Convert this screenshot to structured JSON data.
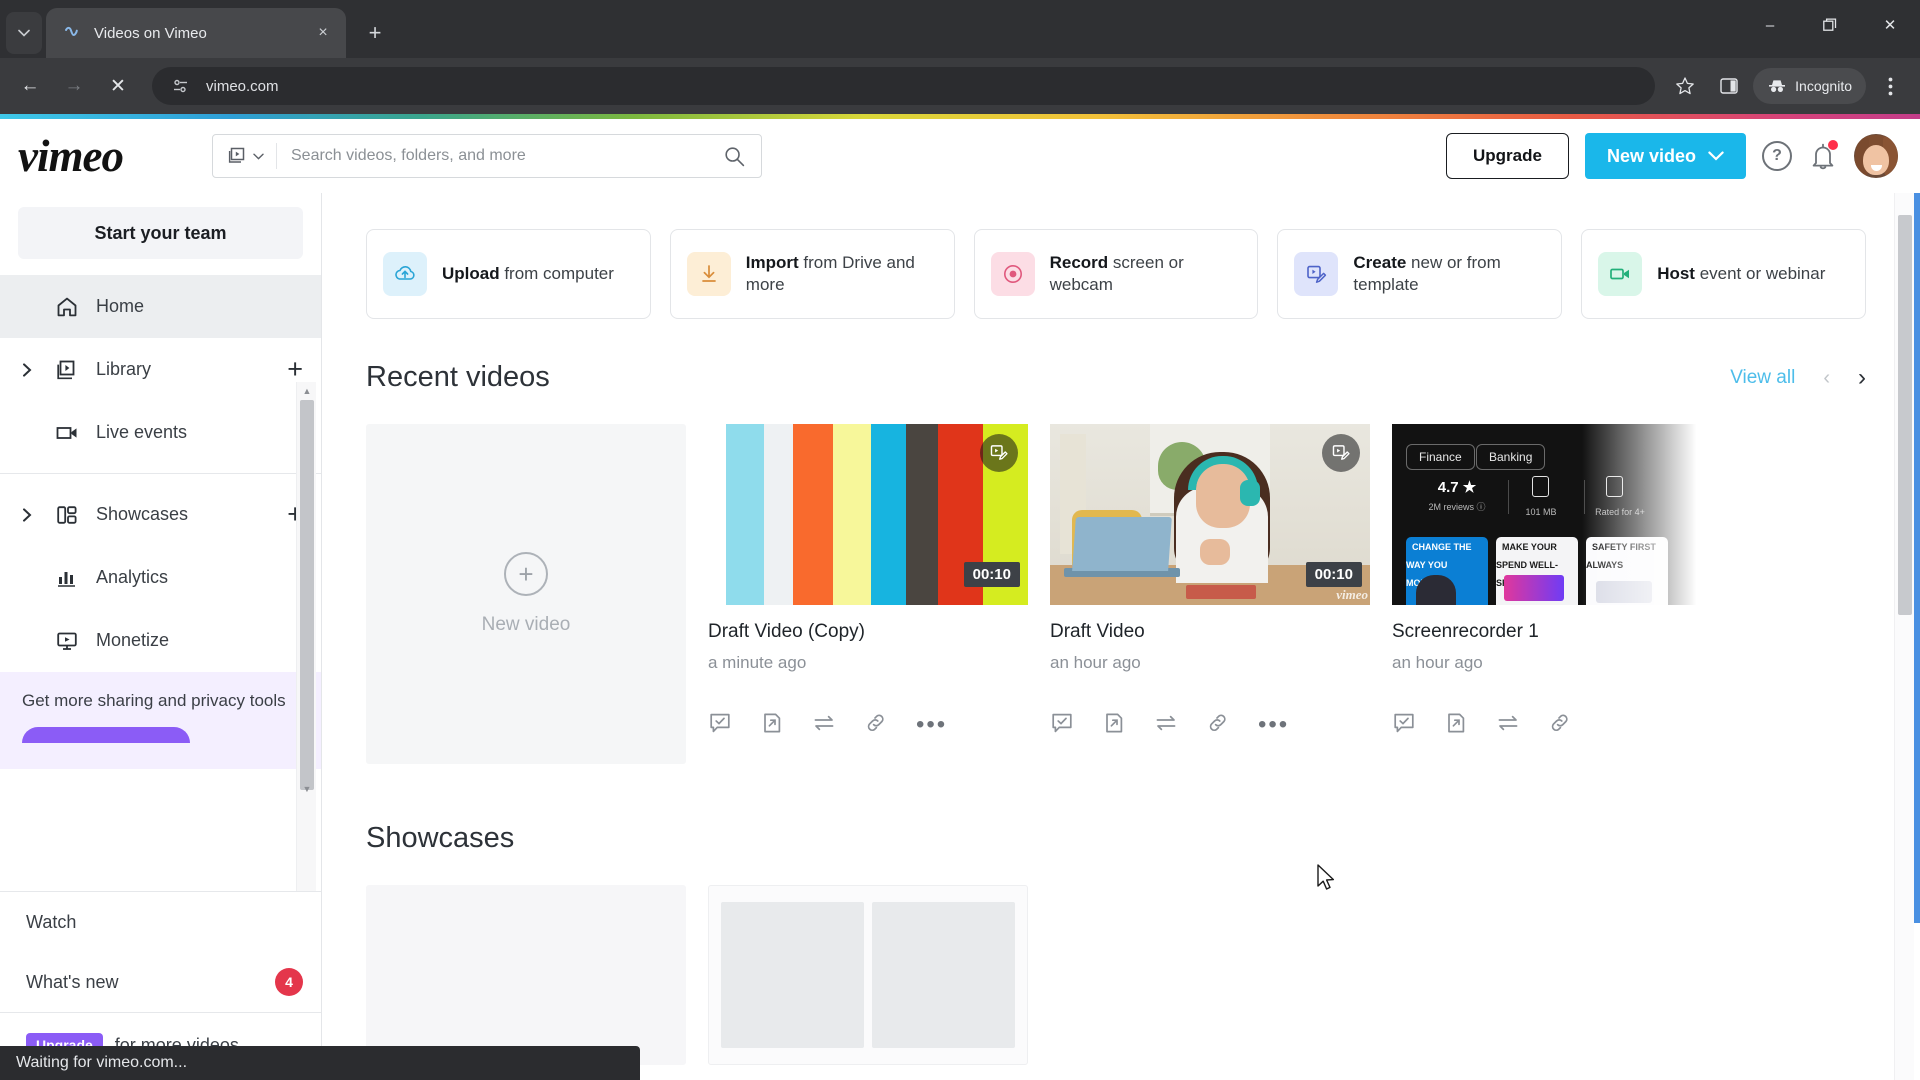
{
  "browser": {
    "tab": {
      "title": "Videos on Vimeo",
      "favicon": "vimeo-favicon",
      "close": "×"
    },
    "tab_list_icon": "chevron-down-icon",
    "new_tab": "+",
    "window_controls": {
      "minimize": "–",
      "maximize": "❐",
      "close": "✕"
    },
    "nav": {
      "back": "←",
      "forward": "→",
      "stop": "✕"
    },
    "omnibox": {
      "url": "vimeo.com",
      "site_info_icon": "site-settings-icon"
    },
    "toolbar_right": {
      "bookmark_icon": "star-icon",
      "sidepanel_icon": "side-panel-icon",
      "incognito_label": "Incognito",
      "incognito_icon": "incognito-hat-icon",
      "menu_icon": "three-dot-menu-icon"
    },
    "status": "Waiting for vimeo.com..."
  },
  "header": {
    "logo": "vimeo",
    "search": {
      "placeholder": "Search videos, folders, and more",
      "value": "",
      "type_icon": "video-filter-icon",
      "type_caret": "chevron-down-icon",
      "submit_icon": "search-icon"
    },
    "upgrade_label": "Upgrade",
    "new_video_label": "New video",
    "new_video_caret": "chevron-down-icon",
    "help_icon": "question-circle-icon",
    "notifications_icon": "bell-icon",
    "notifications_has_unread": true,
    "avatar": "user-avatar"
  },
  "sidebar": {
    "start_team_label": "Start your team",
    "items": [
      {
        "label": "Home",
        "icon": "home-icon",
        "active": true,
        "caret": false,
        "plus": false
      },
      {
        "label": "Library",
        "icon": "library-icon",
        "active": false,
        "caret": true,
        "plus": true
      },
      {
        "label": "Live events",
        "icon": "live-events-icon",
        "active": false,
        "caret": false,
        "plus": false
      }
    ],
    "items2": [
      {
        "label": "Showcases",
        "icon": "showcases-icon",
        "active": false,
        "caret": true,
        "plus": true
      },
      {
        "label": "Analytics",
        "icon": "analytics-icon",
        "active": false,
        "caret": false,
        "plus": false
      },
      {
        "label": "Monetize",
        "icon": "monetize-icon",
        "active": false,
        "caret": false,
        "plus": false
      }
    ],
    "promo": {
      "text": "Get more sharing and privacy tools"
    },
    "bottom": [
      {
        "label": "Watch",
        "badge": null
      },
      {
        "label": "What's new",
        "badge": "4"
      }
    ],
    "upgrade_chip": "Upgrade",
    "upgrade_text": "for more videos"
  },
  "quick_actions": [
    {
      "bold": "Upload",
      "rest": " from computer",
      "icon": "upload-cloud-icon",
      "bg": "#ddf1fb",
      "fg": "#2aa5d6"
    },
    {
      "bold": "Import",
      "rest": " from Drive and more",
      "icon": "import-download-icon",
      "bg": "#fdeed6",
      "fg": "#d98d3a"
    },
    {
      "bold": "Record",
      "rest": " screen or webcam",
      "icon": "record-dot-icon",
      "bg": "#fcdde5",
      "fg": "#e0587d"
    },
    {
      "bold": "Create",
      "rest": " new or from template",
      "icon": "create-edit-icon",
      "bg": "#dfe4fb",
      "fg": "#4e63c8"
    },
    {
      "bold": "Host",
      "rest": " event or webinar",
      "icon": "host-video-icon",
      "bg": "#d9f6e9",
      "fg": "#22b07a"
    }
  ],
  "recent_videos": {
    "title": "Recent videos",
    "view_all": "View all",
    "prev_icon": "chevron-left-icon",
    "next_icon": "chevron-right-icon",
    "new_video_label": "New video",
    "new_video_plus": "+",
    "items": [
      {
        "title": "Draft Video (Copy)",
        "time": "a minute ago",
        "duration": "00:10",
        "thumb": "colorbars",
        "edit_badge": "edit-video-icon",
        "actions": [
          "review-icon",
          "share-out-icon",
          "transfer-icon",
          "link-icon",
          "more-icon"
        ]
      },
      {
        "title": "Draft Video",
        "time": "an hour ago",
        "duration": "00:10",
        "thumb": "woman-with-laptop-photo",
        "edit_badge": "edit-video-icon",
        "watermark": "vimeo",
        "actions": [
          "review-icon",
          "share-out-icon",
          "transfer-icon",
          "link-icon",
          "more-icon"
        ]
      },
      {
        "title": "Screenrecorder 1",
        "time": "an hour ago",
        "duration": "",
        "thumb": "app-store-screenrecording",
        "thumb_chips": [
          "Finance",
          "Banking"
        ],
        "thumb_stats": [
          {
            "big": "4.7 ★",
            "sm": "2M reviews ⓘ"
          },
          {
            "big": "",
            "sm": "101 MB"
          },
          {
            "big": "",
            "sm": "Rated for 4+"
          }
        ],
        "thumb_cards": [
          "CHANGE THE WAY YOU MONEY",
          "MAKE YOUR SPEND WELL-SPENT",
          "SAFETY FIRST ALWAYS"
        ],
        "actions": [
          "review-icon",
          "share-out-icon",
          "transfer-icon",
          "link-icon"
        ]
      }
    ]
  },
  "showcases": {
    "title": "Showcases"
  }
}
